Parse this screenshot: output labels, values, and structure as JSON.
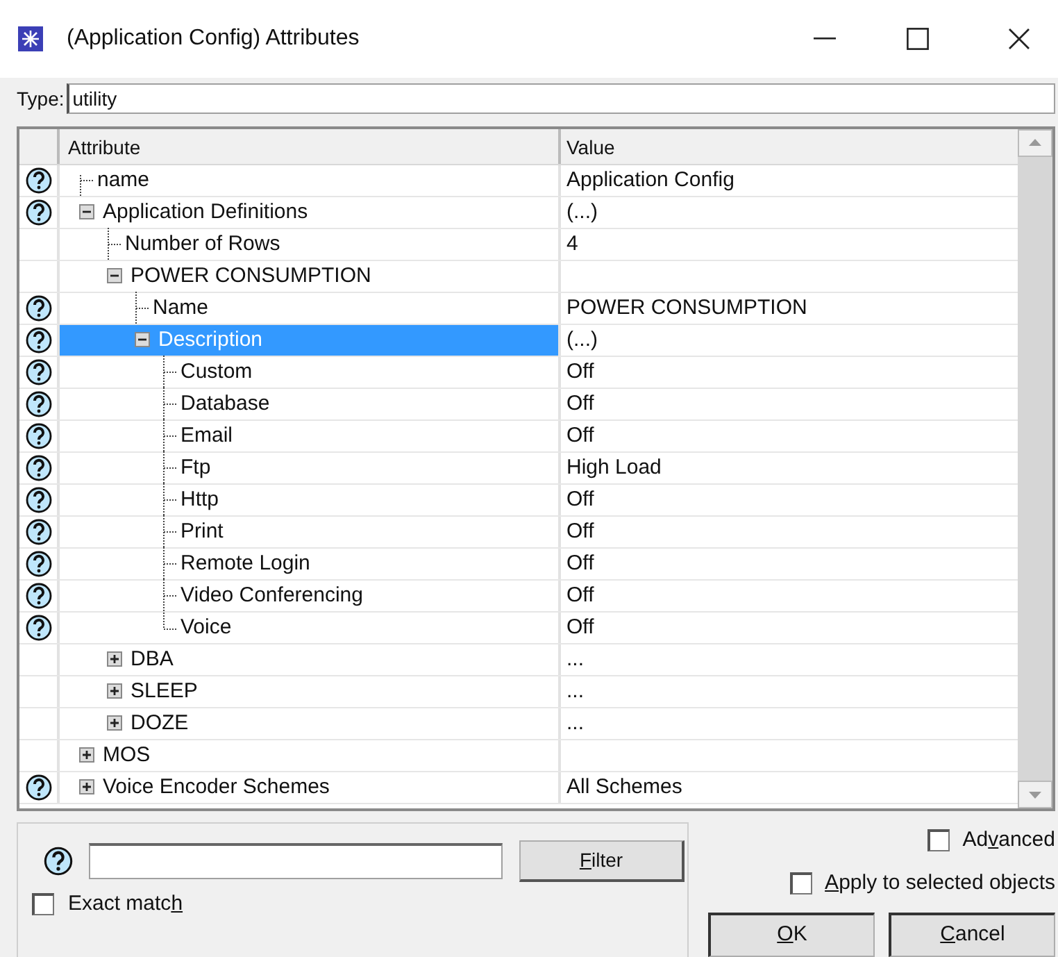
{
  "window": {
    "title": "(Application Config) Attributes"
  },
  "type_field": {
    "label": "Type:",
    "value": "utility"
  },
  "table": {
    "columns": [
      "Attribute",
      "Value"
    ],
    "rows": [
      {
        "label": "name",
        "value": "Application Config",
        "help": true
      },
      {
        "label": "Application Definitions",
        "value": "(...)",
        "help": true,
        "expanded": true,
        "children": [
          {
            "label": "Number of Rows",
            "value": "4",
            "help": false
          },
          {
            "label": "POWER CONSUMPTION",
            "help": false,
            "expanded": true,
            "children": [
              {
                "label": "Name",
                "value": "POWER CONSUMPTION",
                "help": true
              },
              {
                "label": "Description",
                "value": "(...)",
                "help": true,
                "expanded": true,
                "selected": true,
                "children": [
                  {
                    "label": "Custom",
                    "value": "Off",
                    "help": true
                  },
                  {
                    "label": "Database",
                    "value": "Off",
                    "help": true
                  },
                  {
                    "label": "Email",
                    "value": "Off",
                    "help": true
                  },
                  {
                    "label": "Ftp",
                    "value": "High Load",
                    "help": true
                  },
                  {
                    "label": "Http",
                    "value": "Off",
                    "help": true
                  },
                  {
                    "label": "Print",
                    "value": "Off",
                    "help": true
                  },
                  {
                    "label": "Remote Login",
                    "value": "Off",
                    "help": true
                  },
                  {
                    "label": "Video Conferencing",
                    "value": "Off",
                    "help": true
                  },
                  {
                    "label": "Voice",
                    "value": "Off",
                    "help": true
                  }
                ]
              }
            ]
          },
          {
            "label": "DBA",
            "value": "...",
            "help": false,
            "expanded": false
          },
          {
            "label": "SLEEP",
            "value": "...",
            "help": false,
            "expanded": false
          },
          {
            "label": "DOZE",
            "value": "...",
            "help": false,
            "expanded": false
          }
        ]
      },
      {
        "label": "MOS",
        "help": false,
        "expanded": false
      },
      {
        "label": "Voice Encoder Schemes",
        "value": "All Schemes",
        "help": true,
        "expanded": false
      }
    ]
  },
  "filter": {
    "button": {
      "label": {
        "key": "F",
        "after": "ilter"
      }
    },
    "exact_match": {
      "label": {
        "before": "Exact matc",
        "key": "h"
      },
      "checked": false
    }
  },
  "options": [
    {
      "label": {
        "before": "Ad",
        "key": "v",
        "after": "anced"
      },
      "checked": false
    },
    {
      "label": {
        "key": "A",
        "after": "pply to selected objects"
      },
      "checked": false
    }
  ],
  "buttons": [
    {
      "label": {
        "key": "O",
        "after": "K"
      }
    },
    {
      "label": {
        "key": "C",
        "after": "ancel"
      }
    }
  ]
}
